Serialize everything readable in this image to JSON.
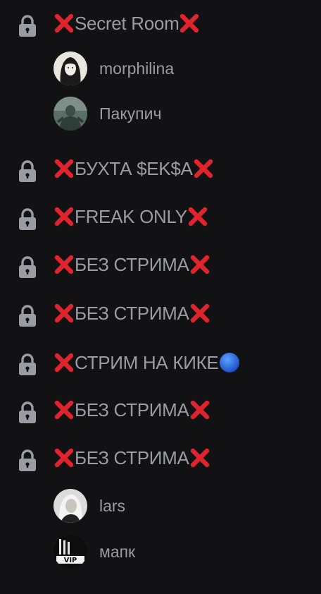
{
  "channels": [
    {
      "title": "Secret Room",
      "prefix": "x-mark",
      "suffix": "x-mark",
      "users": [
        {
          "name": "morphilina"
        },
        {
          "name": "Пакупич"
        }
      ]
    },
    {
      "title": "БУХТА $EK$A",
      "prefix": "x-mark",
      "suffix": "x-mark",
      "users": []
    },
    {
      "title": "FREAK ONLY",
      "prefix": "x-mark",
      "suffix": "x-mark",
      "users": []
    },
    {
      "title": "БЕЗ СТРИМА",
      "prefix": "x-mark",
      "suffix": "x-mark",
      "users": []
    },
    {
      "title": "БЕЗ СТРИМА",
      "prefix": "x-mark",
      "suffix": "x-mark",
      "users": []
    },
    {
      "title": "СТРИМ НА КИКЕ",
      "prefix": "x-mark",
      "suffix": "blue-circle",
      "users": []
    },
    {
      "title": "БЕЗ СТРИМА",
      "prefix": "x-mark",
      "suffix": "x-mark",
      "users": []
    },
    {
      "title": "БЕЗ СТРИМА",
      "prefix": "x-mark",
      "suffix": "x-mark",
      "users": [
        {
          "name": "lars"
        },
        {
          "name": "мапк"
        }
      ]
    }
  ],
  "colors": {
    "background": "#121214",
    "text": "#9b9ca3",
    "x_mark": "#e0242d",
    "blue_circle": "#2f6fe0"
  }
}
